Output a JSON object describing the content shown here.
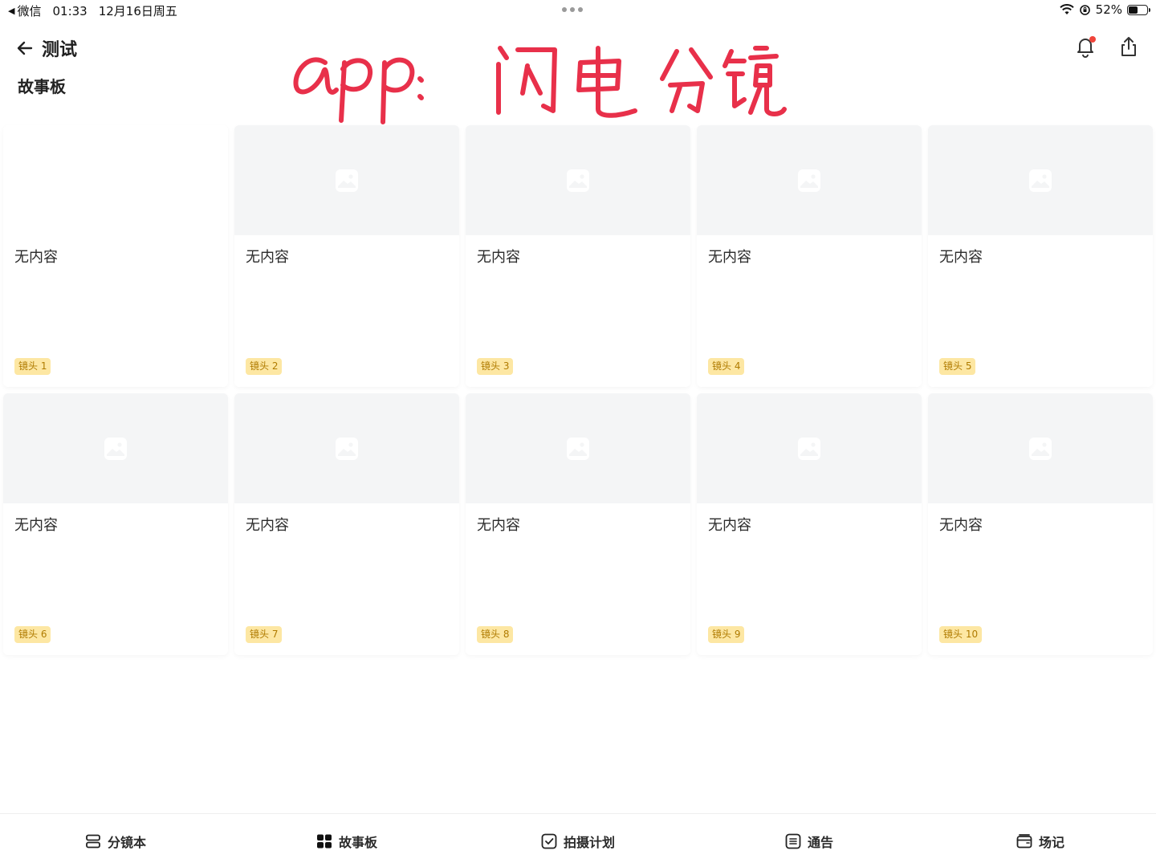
{
  "status_bar": {
    "back_app": "微信",
    "time": "01:33",
    "date": "12月16日周五",
    "battery": "52%",
    "battery_level": 0.52
  },
  "header": {
    "title": "测试",
    "subtitle": "故事板",
    "annotation": "app: 闪电分镜"
  },
  "cards": [
    {
      "text": "无内容",
      "tag": "镜头 1",
      "has_image": false
    },
    {
      "text": "无内容",
      "tag": "镜头 2",
      "has_image": true
    },
    {
      "text": "无内容",
      "tag": "镜头 3",
      "has_image": true
    },
    {
      "text": "无内容",
      "tag": "镜头 4",
      "has_image": true
    },
    {
      "text": "无内容",
      "tag": "镜头 5",
      "has_image": true
    },
    {
      "text": "无内容",
      "tag": "镜头 6",
      "has_image": true
    },
    {
      "text": "无内容",
      "tag": "镜头 7",
      "has_image": true
    },
    {
      "text": "无内容",
      "tag": "镜头 8",
      "has_image": true
    },
    {
      "text": "无内容",
      "tag": "镜头 9",
      "has_image": true
    },
    {
      "text": "无内容",
      "tag": "镜头 10",
      "has_image": true
    }
  ],
  "tabs": [
    {
      "label": "分镜本",
      "icon": "script-icon"
    },
    {
      "label": "故事板",
      "icon": "grid-icon"
    },
    {
      "label": "拍摄计划",
      "icon": "checkbox-icon"
    },
    {
      "label": "通告",
      "icon": "notice-icon"
    },
    {
      "label": "场记",
      "icon": "clapboard-icon"
    }
  ],
  "colors": {
    "annotation": "#e8304a",
    "tag_bg": "#fde7a3",
    "tag_text": "#b07b00",
    "placeholder_bg": "#f4f5f6",
    "notification_dot": "#f0443a"
  }
}
